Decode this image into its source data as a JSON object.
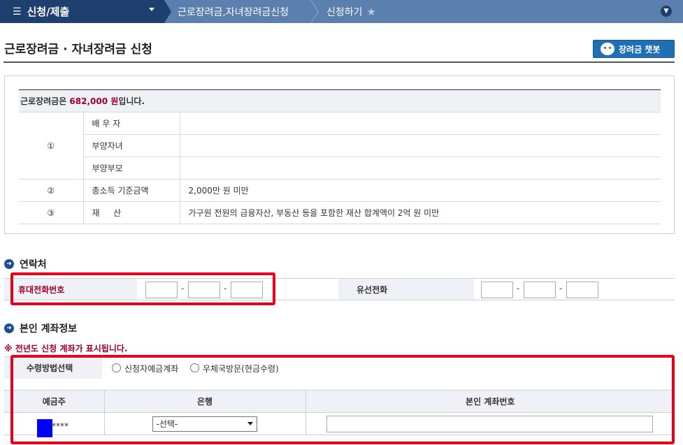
{
  "nav": {
    "menu_title": "신청/제출",
    "crumb1": "근로장려금,자녀장려금신청",
    "crumb2": "신청하기"
  },
  "page": {
    "title": "근로장려금 · 자녀장려금 신청",
    "chatbot_label": "장려금 챗봇"
  },
  "info": {
    "head_prefix": "근로장려금은 ",
    "amount": "682,000 원",
    "head_suffix": "입니다.",
    "rows": [
      {
        "num": "①",
        "label": "배 우 자",
        "value": ""
      },
      {
        "num": "",
        "label": "부양자녀",
        "value": ""
      },
      {
        "num": "",
        "label": "부양부모",
        "value": ""
      },
      {
        "num": "②",
        "label": "총소득 기준금액",
        "value": "2,000만 원 미만"
      },
      {
        "num": "③",
        "label": "재 　 산",
        "value": "가구원 전원의 금융자산, 부동산 등을 포함한 재산 합계액이 2억 원 미만"
      }
    ]
  },
  "contact": {
    "heading": "연락처",
    "mobile_label": "휴대전화번호",
    "tel_label": "유선전화",
    "dash": "-"
  },
  "account": {
    "heading": "본인 계좌정보",
    "notice": "※ 전년도 신청 계좌가 표시됩니다.",
    "method_label": "수령방법선택",
    "option1": "신청자예금계좌",
    "option2": "우체국방문(현금수령)",
    "col_holder": "예금주",
    "col_bank": "은행",
    "col_number": "본인 계좌번호",
    "holder_masked": "****",
    "bank_selected": "-선택-"
  },
  "colors": {
    "nav_dark": "#1f3f6e",
    "nav_light": "#5b7fae",
    "accent_red": "#a3002d",
    "highlight": "#e8001c"
  }
}
